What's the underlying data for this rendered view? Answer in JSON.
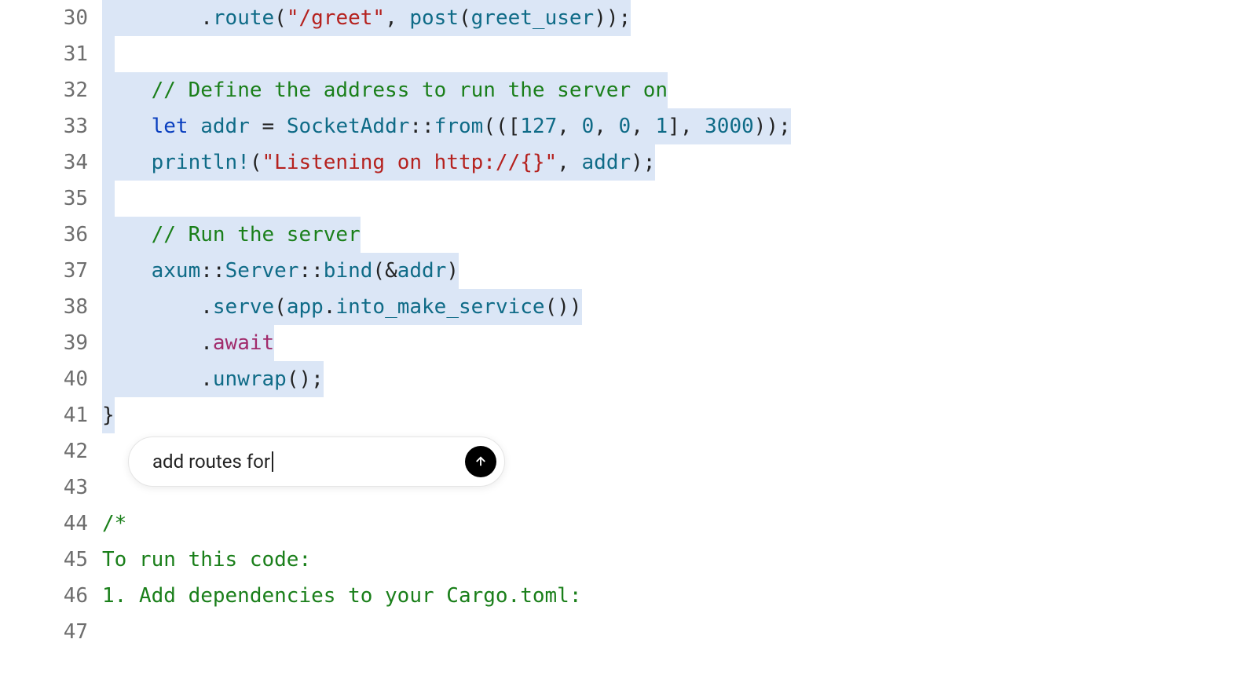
{
  "gutter": {
    "start": 30,
    "lines": [
      "30",
      "31",
      "32",
      "33",
      "34",
      "35",
      "36",
      "37",
      "38",
      "39",
      "40",
      "41",
      "42",
      "43",
      "44",
      "45",
      "46",
      "47"
    ]
  },
  "code": {
    "l30": {
      "indent": "        ",
      "punc0": ".",
      "route": "route",
      "paren0": "(",
      "quote0": "\"",
      "path": "/greet",
      "quote1": "\"",
      "comma": ", ",
      "post": "post",
      "paren1": "(",
      "handler": "greet_user",
      "paren2": "));"
    },
    "l31": "",
    "l32": {
      "indent": "    ",
      "comment": "// Define the address to run the server on"
    },
    "l33": {
      "indent": "    ",
      "let": "let",
      "sp0": " ",
      "addr": "addr",
      "sp1": " ",
      "eq": "=",
      "sp2": " ",
      "type": "SocketAddr",
      "colons": "::",
      "from": "from",
      "open": "(([",
      "n0": "127",
      "c0": ", ",
      "n1": "0",
      "c1": ", ",
      "n2": "0",
      "c2": ", ",
      "n3": "1",
      "close0": "], ",
      "port": "3000",
      "close1": "));"
    },
    "l34": {
      "indent": "    ",
      "macro": "println!",
      "open": "(",
      "str": "\"Listening on http://{}\"",
      "comma": ", ",
      "addr": "addr",
      "close": ");"
    },
    "l35": "",
    "l36": {
      "indent": "    ",
      "comment": "// Run the server"
    },
    "l37": {
      "indent": "    ",
      "axum": "axum",
      "sep0": "::",
      "server": "Server",
      "sep1": "::",
      "bind": "bind",
      "open": "(&",
      "addr": "addr",
      "close": ")"
    },
    "l38": {
      "indent": "        ",
      "dot": ".",
      "serve": "serve",
      "open": "(",
      "app": "app",
      "dot2": ".",
      "into": "into_make_service",
      "close": "())"
    },
    "l39": {
      "indent": "        ",
      "dot": ".",
      "await": "await"
    },
    "l40": {
      "indent": "        ",
      "dot": ".",
      "unwrap": "unwrap",
      "close": "();"
    },
    "l41": "}",
    "l42": "",
    "l43": "",
    "l44": "/*",
    "l45": "To run this code:",
    "l46": "1. Add dependencies to your Cargo.toml:",
    "l47": ""
  },
  "popup": {
    "text": "add routes for ",
    "aria_send": "Send"
  }
}
